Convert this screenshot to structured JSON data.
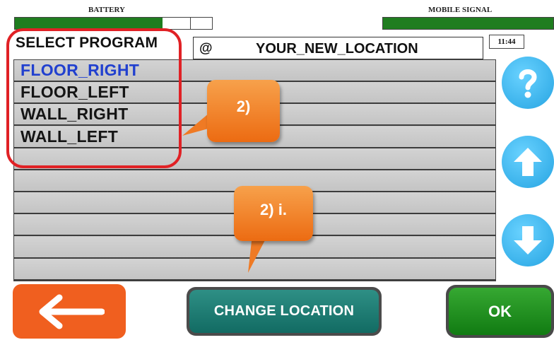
{
  "status": {
    "battery_label": "BATTERY",
    "battery_level": 0.75,
    "signal_label": "MOBILE SIGNAL",
    "signal_level": 1.0,
    "fill_color": "#1f7d1f"
  },
  "header": {
    "title": "SELECT PROGRAM",
    "location_prefix": "@",
    "location": "YOUR_NEW_LOCATION",
    "time": "11:44"
  },
  "programs": [
    {
      "label": "FLOOR_RIGHT",
      "selected": true
    },
    {
      "label": "FLOOR_LEFT",
      "selected": false
    },
    {
      "label": "WALL_RIGHT",
      "selected": false
    },
    {
      "label": "WALL_LEFT",
      "selected": false
    },
    {
      "label": "",
      "selected": false
    },
    {
      "label": "",
      "selected": false
    },
    {
      "label": "",
      "selected": false
    },
    {
      "label": "",
      "selected": false
    },
    {
      "label": "",
      "selected": false
    },
    {
      "label": "",
      "selected": false
    }
  ],
  "callouts": {
    "first": "2)",
    "second": "2) i."
  },
  "side_buttons": {
    "help_icon": "question-icon",
    "up_icon": "arrow-up-icon",
    "down_icon": "arrow-down-icon"
  },
  "footer": {
    "back_icon": "arrow-left-icon",
    "change_location_label": "CHANGE LOCATION",
    "ok_label": "OK"
  },
  "colors": {
    "selected_text": "#2140cf",
    "highlight_frame": "#e02125",
    "callout": "#ec6b12",
    "side_buttons": "#26a4e2",
    "back_button": "#f05f1f",
    "change_location_button": "#1a7a72",
    "ok_button": "#1f8f1f"
  }
}
